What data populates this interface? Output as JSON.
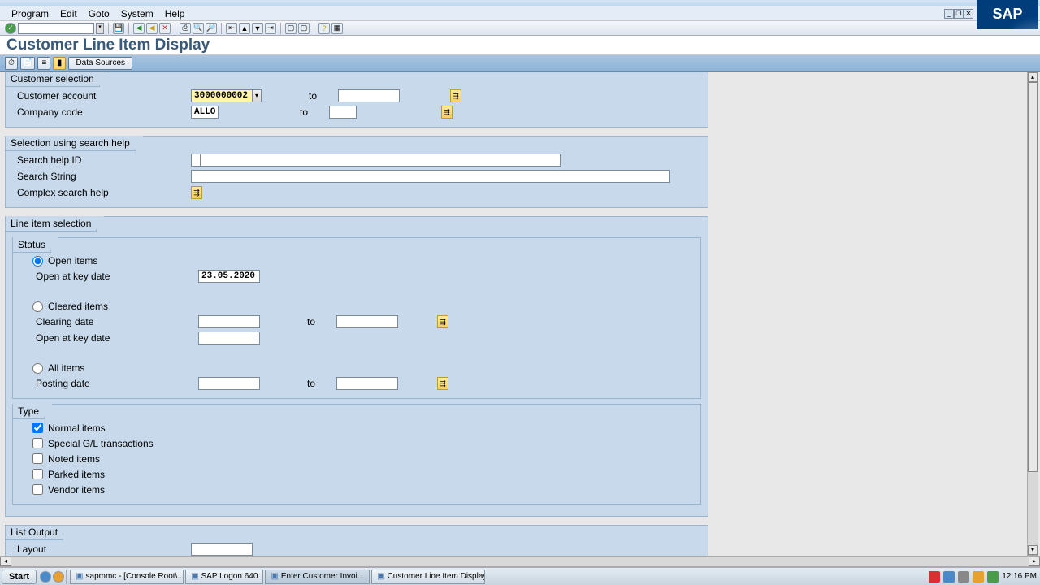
{
  "titlebar": {
    "sap_logo": "SAP"
  },
  "menu": {
    "program": "Program",
    "edit": "Edit",
    "goto": "Goto",
    "system": "System",
    "help": "Help"
  },
  "page_title": "Customer Line Item Display",
  "app_toolbar": {
    "data_sources": "Data Sources"
  },
  "customer_selection": {
    "title": "Customer selection",
    "account_label": "Customer account",
    "account_value": "3000000002",
    "company_label": "Company code",
    "company_value": "ALLO",
    "to": "to"
  },
  "search_help": {
    "title": "Selection using search help",
    "id_label": "Search help ID",
    "string_label": "Search String",
    "complex_label": "Complex search help"
  },
  "line_item": {
    "title": "Line item selection",
    "status": {
      "title": "Status",
      "open_items": "Open items",
      "open_key_date": "Open at key date",
      "open_key_date_value": "23.05.2020",
      "cleared_items": "Cleared items",
      "clearing_date": "Clearing date",
      "open_key_date2": "Open at key date",
      "all_items": "All items",
      "posting_date": "Posting date",
      "to": "to"
    },
    "type": {
      "title": "Type",
      "normal": "Normal items",
      "special": "Special G/L transactions",
      "noted": "Noted items",
      "parked": "Parked items",
      "vendor": "Vendor items"
    }
  },
  "list_output": {
    "title": "List Output",
    "layout_label": "Layout"
  },
  "taskbar": {
    "start": "Start",
    "items": [
      "sapmmc - [Console Root\\...",
      "SAP Logon 640",
      "Enter Customer Invoi...",
      "Customer Line Item Display"
    ],
    "clock": "12:16 PM"
  }
}
